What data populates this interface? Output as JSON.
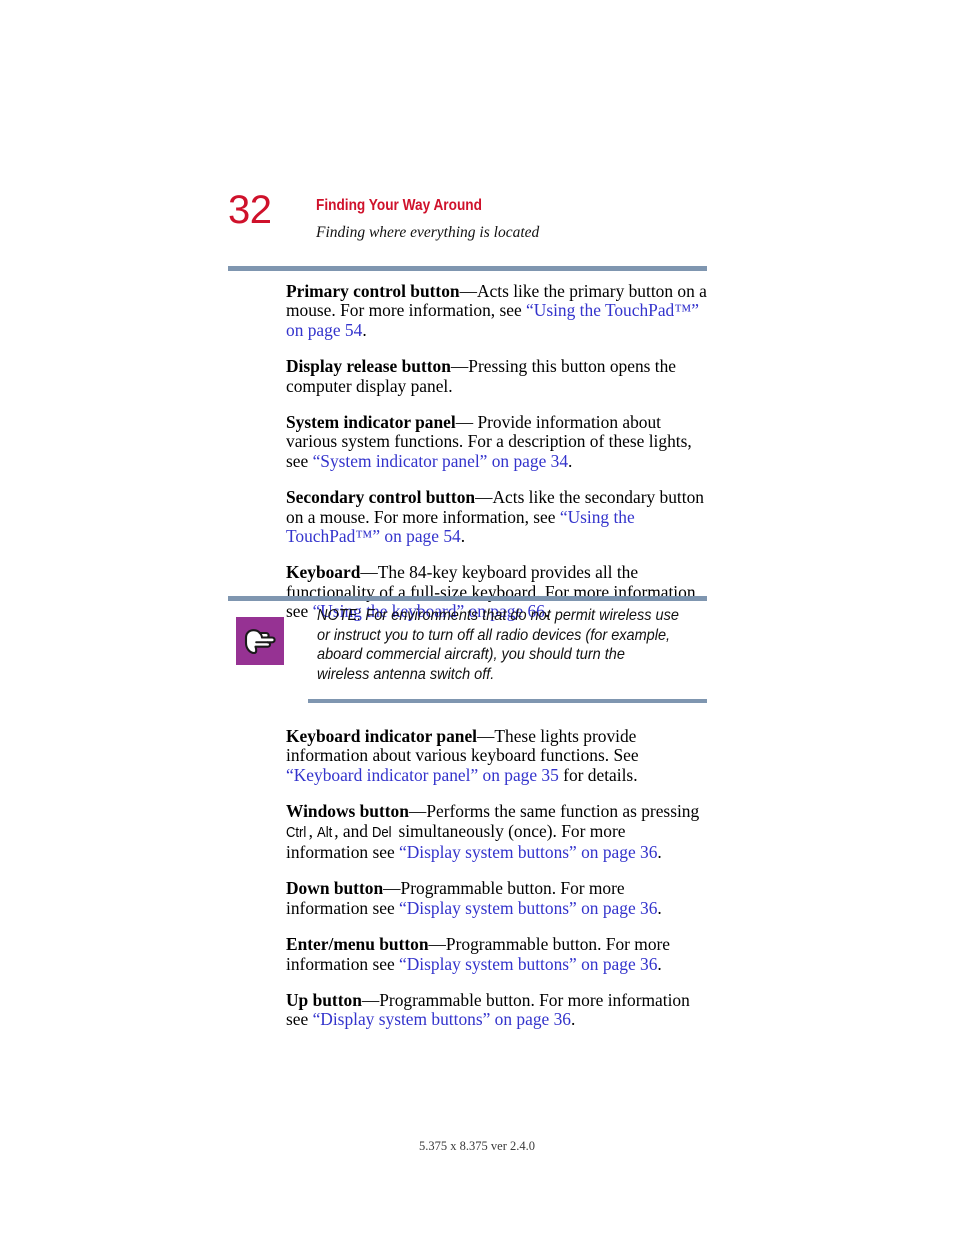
{
  "page": {
    "folio": "32",
    "chapter_title": "Finding Your Way Around",
    "section_subtitle": "Finding where everything is located",
    "footer": "5.375 x 8.375 ver 2.4.0",
    "accent_red": "#cf112b",
    "rule_color": "#7f96b0",
    "link_color": "#3333cc",
    "note_icon_color": "#963293"
  },
  "body_top": [
    {
      "term": "Primary control button",
      "text_1": "—Acts like the primary button on a mouse. For more information, see ",
      "link_1": "“Using the TouchPad™” on page 54",
      "text_2": "."
    },
    {
      "term": "Display release button",
      "text_1": "—Pressing this button opens the computer display panel.",
      "link_1": "",
      "text_2": ""
    },
    {
      "term": "System indicator panel",
      "text_1": "— Provide information about various system functions. For a description of these lights, see ",
      "link_1": "“System indicator panel” on page 34",
      "text_2": "."
    },
    {
      "term": "Secondary control button",
      "text_1": "—Acts like the secondary button on a mouse. For more information, see ",
      "link_1": "“Using the TouchPad™” on page 54",
      "text_2": "."
    },
    {
      "term": "Keyboard",
      "text_1": "—The 84-key keyboard provides all the functionality of a full-size keyboard. For more information, see ",
      "link_1": "“Using the keyboard” on page 66",
      "text_2": "."
    }
  ],
  "note": {
    "icon_name": "pointing-hand-icon",
    "text": "NOTE: For environments that do not permit wireless use or instruct you to turn off all radio devices (for example, aboard commercial aircraft), you should turn the wireless antenna switch off."
  },
  "body_bottom": [
    {
      "term": "Keyboard indicator panel",
      "text_1": "—These lights provide information about various keyboard functions. See ",
      "link_1": "“Keyboard indicator panel” on page 35",
      "text_2": " for details.",
      "keycaps": []
    },
    {
      "term": "Windows button",
      "text_1": "—Performs the same function as pressing ",
      "keycaps": [
        "Ctrl",
        "Alt",
        "Del"
      ],
      "text_mid_a": ", ",
      "text_mid_b": ", and ",
      "text_mid_c": " simultaneously (once). For more information see ",
      "link_1": "“Display system buttons” on page 36",
      "text_2": "."
    },
    {
      "term": "Down button",
      "text_1": "—Programmable button. For more information see ",
      "link_1": "“Display system buttons” on page 36",
      "text_2": ".",
      "keycaps": []
    },
    {
      "term": "Enter/menu button",
      "text_1": "—Programmable button. For more information see ",
      "link_1": "“Display system buttons” on page 36",
      "text_2": ".",
      "keycaps": []
    },
    {
      "term": "Up button",
      "text_1": "—Programmable button. For more information see ",
      "link_1": "“Display system buttons” on page 36",
      "text_2": ".",
      "keycaps": []
    }
  ]
}
